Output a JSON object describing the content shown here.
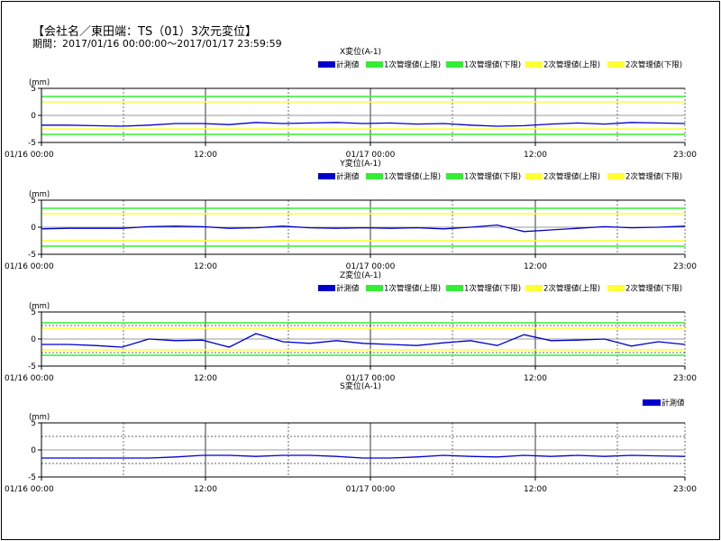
{
  "header": {
    "title": "【会社名／東田端：TS（01）3次元変位】",
    "period": "期間：2017/01/16 00:00:00～2017/01/17 23:59:59"
  },
  "colors": {
    "measured": "#0000cc",
    "level1": "#33ee33",
    "level2": "#ffff33",
    "axis": "#000000",
    "grid": "#333333"
  },
  "x_ticks": [
    "01/16 00:00",
    "12:00",
    "01/17 00:00",
    "12:00",
    "23:00"
  ],
  "chart_data": [
    {
      "type": "line",
      "title": "X変位(A-1)",
      "ylabel": "(mm)",
      "ylim": [
        -5,
        5
      ],
      "yticks": [
        "5",
        "0",
        "-5"
      ],
      "legend": [
        "計測値",
        "1次管理値(上限)",
        "1次管理値(下限)",
        "2次管理値(上限)",
        "2次管理値(下限)"
      ],
      "thresholds": {
        "level1_upper": 3.5,
        "level1_lower": -3.5,
        "level2_upper": 2.5,
        "level2_lower": -2.5
      },
      "series": [
        {
          "name": "計測値",
          "values": [
            -1.8,
            -1.8,
            -1.9,
            -2.0,
            -1.8,
            -1.5,
            -1.5,
            -1.7,
            -1.3,
            -1.5,
            -1.4,
            -1.3,
            -1.5,
            -1.4,
            -1.6,
            -1.5,
            -1.8,
            -2.0,
            -1.9,
            -1.6,
            -1.4,
            -1.6,
            -1.3,
            -1.4,
            -1.5
          ]
        }
      ]
    },
    {
      "type": "line",
      "title": "Y変位(A-1)",
      "ylabel": "(mm)",
      "ylim": [
        -5,
        5
      ],
      "yticks": [
        "5",
        "0",
        "-5"
      ],
      "legend": [
        "計測値",
        "1次管理値(上限)",
        "1次管理値(下限)",
        "2次管理値(上限)",
        "2次管理値(下限)"
      ],
      "thresholds": {
        "level1_upper": 3.5,
        "level1_lower": -3.5,
        "level2_upper": 2.5,
        "level2_lower": -2.5
      },
      "series": [
        {
          "name": "計測値",
          "values": [
            -0.3,
            -0.2,
            -0.2,
            -0.2,
            0.1,
            0.2,
            0.1,
            -0.2,
            -0.1,
            0.2,
            -0.1,
            -0.2,
            -0.1,
            -0.2,
            -0.1,
            -0.3,
            0.0,
            0.4,
            -0.8,
            -0.5,
            -0.2,
            0.1,
            -0.1,
            0.0,
            0.2
          ]
        }
      ]
    },
    {
      "type": "line",
      "title": "Z変位(A-1)",
      "ylabel": "(mm)",
      "ylim": [
        -5,
        5
      ],
      "yticks": [
        "5",
        "0",
        "-5"
      ],
      "legend": [
        "計測値",
        "1次管理値(上限)",
        "1次管理値(下限)",
        "2次管理値(上限)",
        "2次管理値(下限)"
      ],
      "thresholds": {
        "level1_upper": 3.0,
        "level1_lower": -3.0,
        "level2_upper": 2.0,
        "level2_lower": -2.0
      },
      "series": [
        {
          "name": "計測値",
          "values": [
            -1.0,
            -1.0,
            -1.2,
            -1.5,
            0.0,
            -0.3,
            -0.2,
            -1.5,
            1.0,
            -0.5,
            -0.8,
            -0.3,
            -0.8,
            -1.0,
            -1.2,
            -0.7,
            -0.3,
            -1.2,
            0.8,
            -0.3,
            -0.2,
            0.0,
            -1.3,
            -0.5,
            -1.0
          ]
        }
      ]
    },
    {
      "type": "line",
      "title": "S変位(A-1)",
      "ylabel": "(mm)",
      "ylim": [
        -5,
        5
      ],
      "yticks": [
        "5",
        "0",
        "-5"
      ],
      "legend": [
        "計測値"
      ],
      "series": [
        {
          "name": "計測値",
          "values": [
            -1.5,
            -1.5,
            -1.5,
            -1.5,
            -1.5,
            -1.3,
            -1.0,
            -1.0,
            -1.2,
            -1.0,
            -1.0,
            -1.2,
            -1.5,
            -1.5,
            -1.3,
            -1.0,
            -1.2,
            -1.3,
            -1.0,
            -1.2,
            -1.0,
            -1.2,
            -1.0,
            -1.1,
            -1.2
          ]
        }
      ]
    }
  ]
}
